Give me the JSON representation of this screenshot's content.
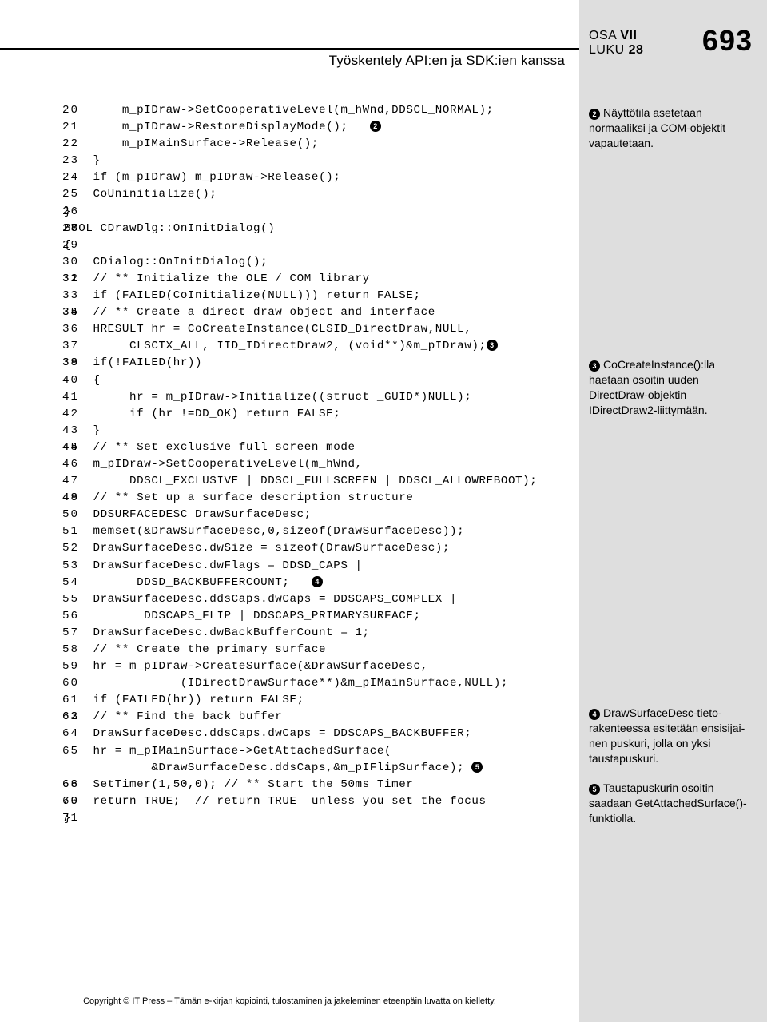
{
  "header": {
    "chapter_title": "Työskentely API:en ja SDK:ien kanssa",
    "osa_label": "OSA",
    "osa_num": "VII",
    "luku_label": "LUKU",
    "luku_num": "28",
    "page_number": "693"
  },
  "code": {
    "lines": [
      {
        "n": "20",
        "t": "        m_pIDraw->SetCooperativeLevel(m_hWnd,DDSCL_NORMAL);"
      },
      {
        "n": "21",
        "t": "        m_pIDraw->RestoreDisplayMode();   ",
        "m": "2"
      },
      {
        "n": "22",
        "t": "        m_pIMainSurface->Release();"
      },
      {
        "n": "23",
        "t": "    }"
      },
      {
        "n": "24",
        "t": "    if (m_pIDraw) m_pIDraw->Release();"
      },
      {
        "n": "25",
        "t": "    CoUninitialize();"
      },
      {
        "n": "26",
        "t": "}"
      },
      {
        "n": "27",
        "t": ""
      },
      {
        "n": "28",
        "t": "BOOL CDrawDlg::OnInitDialog()"
      },
      {
        "n": "29",
        "t": "{"
      },
      {
        "n": "30",
        "t": "    CDialog::OnInitDialog();"
      },
      {
        "n": "31",
        "t": ""
      },
      {
        "n": "32",
        "t": "    // ** Initialize the OLE / COM library"
      },
      {
        "n": "33",
        "t": "    if (FAILED(CoInitialize(NULL))) return FALSE;"
      },
      {
        "n": "34",
        "t": ""
      },
      {
        "n": "35",
        "t": "    // ** Create a direct draw object and interface"
      },
      {
        "n": "36",
        "t": "    HRESULT hr = CoCreateInstance(CLSID_DirectDraw,NULL,"
      },
      {
        "n": "37",
        "t": "         CLSCTX_ALL, IID_IDirectDraw2, (void**)&m_pIDraw);",
        "m": "3"
      },
      {
        "n": "38",
        "t": ""
      },
      {
        "n": "39",
        "t": "    if(!FAILED(hr))"
      },
      {
        "n": "40",
        "t": "    {"
      },
      {
        "n": "41",
        "t": "         hr = m_pIDraw->Initialize((struct _GUID*)NULL);"
      },
      {
        "n": "42",
        "t": "         if (hr !=DD_OK) return FALSE;"
      },
      {
        "n": "43",
        "t": "    }"
      },
      {
        "n": "44",
        "t": ""
      },
      {
        "n": "45",
        "t": "    // ** Set exclusive full screen mode"
      },
      {
        "n": "46",
        "t": "    m_pIDraw->SetCooperativeLevel(m_hWnd,"
      },
      {
        "n": "47",
        "t": "         DDSCL_EXCLUSIVE | DDSCL_FULLSCREEN | DDSCL_ALLOWREBOOT);"
      },
      {
        "n": "48",
        "t": ""
      },
      {
        "n": "49",
        "t": "    // ** Set up a surface description structure"
      },
      {
        "n": "50",
        "t": "    DDSURFACEDESC DrawSurfaceDesc;"
      },
      {
        "n": "51",
        "t": "    memset(&DrawSurfaceDesc,0,sizeof(DrawSurfaceDesc));"
      },
      {
        "n": "52",
        "t": "    DrawSurfaceDesc.dwSize = sizeof(DrawSurfaceDesc);"
      },
      {
        "n": "53",
        "t": "    DrawSurfaceDesc.dwFlags = DDSD_CAPS |"
      },
      {
        "n": "54",
        "t": "          DDSD_BACKBUFFERCOUNT;   ",
        "m": "4"
      },
      {
        "n": "55",
        "t": "    DrawSurfaceDesc.ddsCaps.dwCaps = DDSCAPS_COMPLEX |"
      },
      {
        "n": "56",
        "t": "           DDSCAPS_FLIP | DDSCAPS_PRIMARYSURFACE;"
      },
      {
        "n": "57",
        "t": "    DrawSurfaceDesc.dwBackBufferCount = 1;"
      },
      {
        "n": "58",
        "t": "    // ** Create the primary surface"
      },
      {
        "n": "59",
        "t": "    hr = m_pIDraw->CreateSurface(&DrawSurfaceDesc,"
      },
      {
        "n": "60",
        "t": "                (IDirectDrawSurface**)&m_pIMainSurface,NULL);"
      },
      {
        "n": "61",
        "t": "    if (FAILED(hr)) return FALSE;"
      },
      {
        "n": "62",
        "t": ""
      },
      {
        "n": "63",
        "t": "    // ** Find the back buffer"
      },
      {
        "n": "64",
        "t": "    DrawSurfaceDesc.ddsCaps.dwCaps = DDSCAPS_BACKBUFFER;"
      },
      {
        "n": "65",
        "t": "    hr = m_pIMainSurface->GetAttachedSurface("
      },
      {
        "n": "",
        "t": "            &DrawSurfaceDesc.ddsCaps,&m_pIFlipSurface); ",
        "m": "5"
      },
      {
        "n": "66",
        "t": ""
      },
      {
        "n": "68",
        "t": "    SetTimer(1,50,0); // ** Start the 50ms Timer"
      },
      {
        "n": "69",
        "t": ""
      },
      {
        "n": "70",
        "t": "    return TRUE;  // return TRUE  unless you set the focus"
      },
      {
        "n": "71",
        "t": "}"
      }
    ]
  },
  "annotations": {
    "a2": {
      "num": "2",
      "text": "Näyttötila asetetaan normaaliksi ja COM-objektit vapautetaan."
    },
    "a3": {
      "num": "3",
      "text": "CoCreateInstance():lla haetaan osoitin uuden DirectDraw-objektin IDirectDraw2-liittymään."
    },
    "a4": {
      "num": "4",
      "text": "DrawSurfaceDesc-tieto­rakenteessa esitetään ensisijai­nen puskuri, jolla on yksi taustapuskuri."
    },
    "a5": {
      "num": "5",
      "text": "Taustapuskurin osoitin saadaan GetAttachedSurface()-funktiolla."
    }
  },
  "footer": "Copyright © IT Press – Tämän e-kirjan kopiointi, tulostaminen ja jakeleminen eteenpäin luvatta on kielletty."
}
